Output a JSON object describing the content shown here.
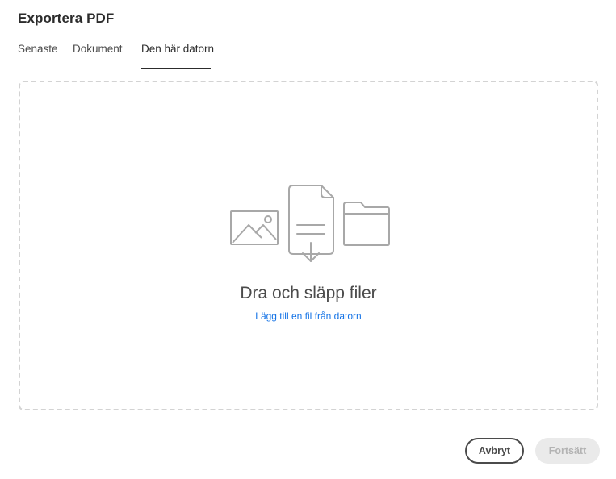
{
  "dialog": {
    "title": "Exportera PDF"
  },
  "tabs": [
    {
      "label": "Senaste",
      "active": false
    },
    {
      "label": "Dokument",
      "active": false
    },
    {
      "label": "Den här datorn",
      "active": true
    }
  ],
  "dropzone": {
    "title": "Dra och släpp filer",
    "link": "Lägg till en fil från datorn",
    "icons": [
      "image-icon",
      "document-download-icon",
      "folder-icon"
    ]
  },
  "footer": {
    "cancel_label": "Avbryt",
    "continue_label": "Fortsätt",
    "continue_enabled": false
  },
  "colors": {
    "link": "#1473e6",
    "text": "#2c2c2c",
    "border": "#d3d3d3",
    "icon": "#a8a8a8"
  }
}
